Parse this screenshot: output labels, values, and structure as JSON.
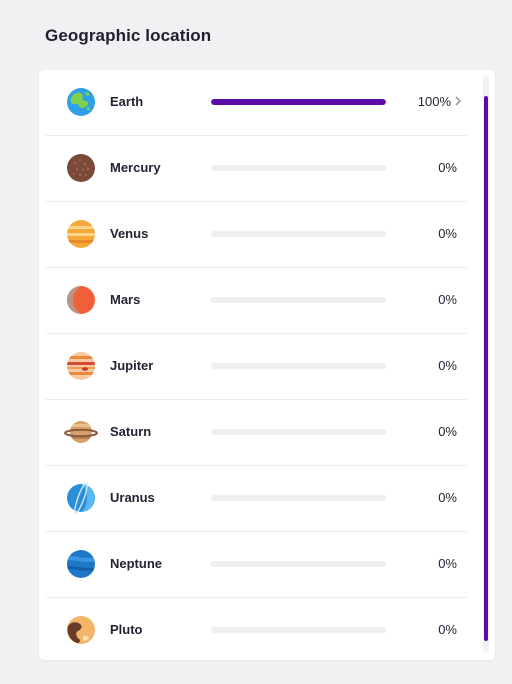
{
  "section": {
    "title": "Geographic location"
  },
  "colors": {
    "accent": "#5c0aa8",
    "track": "#efeff1"
  },
  "rows": [
    {
      "name": "Earth",
      "icon": "earth-icon",
      "percent_label": "100%",
      "percent": 100,
      "has_chevron": true
    },
    {
      "name": "Mercury",
      "icon": "mercury-icon",
      "percent_label": "0%",
      "percent": 0
    },
    {
      "name": "Venus",
      "icon": "venus-icon",
      "percent_label": "0%",
      "percent": 0
    },
    {
      "name": "Mars",
      "icon": "mars-icon",
      "percent_label": "0%",
      "percent": 0
    },
    {
      "name": "Jupiter",
      "icon": "jupiter-icon",
      "percent_label": "0%",
      "percent": 0
    },
    {
      "name": "Saturn",
      "icon": "saturn-icon",
      "percent_label": "0%",
      "percent": 0
    },
    {
      "name": "Uranus",
      "icon": "uranus-icon",
      "percent_label": "0%",
      "percent": 0
    },
    {
      "name": "Neptune",
      "icon": "neptune-icon",
      "percent_label": "0%",
      "percent": 0
    },
    {
      "name": "Pluto",
      "icon": "pluto-icon",
      "percent_label": "0%",
      "percent": 0
    }
  ]
}
